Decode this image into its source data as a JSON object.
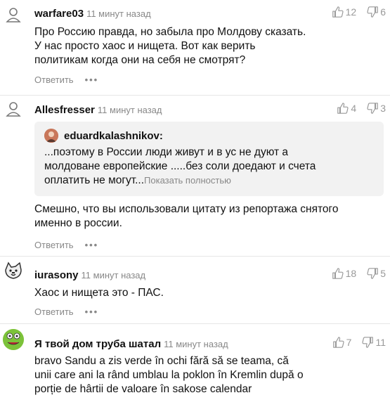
{
  "comments": [
    {
      "author": "warfare03",
      "time": "11 минут назад",
      "text": "Про Россию правда, но забыла про Молдову сказать.\nУ нас просто хаос и нищета. Вот как верить\nполитикам когда они на себя не смотрят?",
      "likes": "12",
      "dislikes": "6",
      "reply": "Ответить"
    },
    {
      "author": "Allesfresser",
      "time": "11 минут назад",
      "quote_author": "eduardkalashnikov:",
      "quote_text": "...поэтому в России люди живут и в ус не дуют а\nмолдоване европейские .....без соли доедают и счета\nоплатить не могут...",
      "quote_more": "Показать полностью",
      "text": "Смешно, что вы использовали цитату из репортажа снятого\nименно в россии.",
      "likes": "4",
      "dislikes": "3",
      "reply": "Ответить"
    },
    {
      "author": "iurasony",
      "time": "11 минут назад",
      "text": "Хаос и нищета это - ПАС.",
      "likes": "18",
      "dislikes": "5",
      "reply": "Ответить"
    },
    {
      "author": "Я твой дом труба шатал",
      "time": "11 минут назад",
      "text": "bravo Sandu a zis verde în ochi fără să se teama, că\nunii care ani la rând umblau la poklon în Kremlin după o\nporție de hârtii de valoare în sakose calendar",
      "likes": "7",
      "dislikes": "11"
    }
  ],
  "icons": {
    "like": "thumb-up-icon",
    "dislike": "thumb-down-icon",
    "more": "more-dots-icon",
    "avatar": "user-icon"
  },
  "colors": {
    "muted": "#888888",
    "quote_bg": "#f2f2f2"
  }
}
